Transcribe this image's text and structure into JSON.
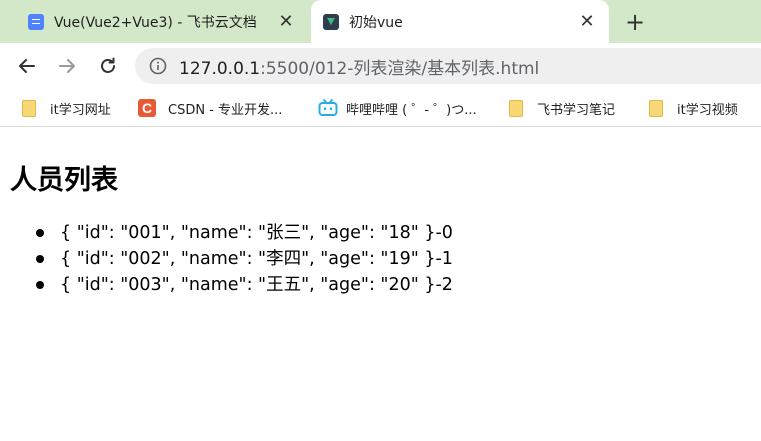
{
  "tabs": [
    {
      "title": "Vue(Vue2+Vue3) - 飞书云文档",
      "active": false
    },
    {
      "title": "初始vue",
      "active": true
    }
  ],
  "toolbar": {
    "url_host": "127.0.0.1",
    "url_rest": ":5500/012-列表渲染/基本列表.html"
  },
  "bookmarks": [
    {
      "label": "it学习网址",
      "icon": "folder-icon"
    },
    {
      "label": "CSDN - 专业开发...",
      "icon": "csdn-icon"
    },
    {
      "label": "哔哩哔哩 ( ゜- ゜)つ...",
      "icon": "bilibili-icon"
    },
    {
      "label": "飞书学习笔记",
      "icon": "folder-icon"
    },
    {
      "label": "it学习视频",
      "icon": "folder-icon"
    }
  ],
  "page": {
    "title": "人员列表",
    "items": [
      "{ \"id\": \"001\", \"name\": \"张三\", \"age\": \"18\" }-0",
      "{ \"id\": \"002\", \"name\": \"李四\", \"age\": \"19\" }-1",
      "{ \"id\": \"003\", \"name\": \"王五\", \"age\": \"20\" }-2"
    ]
  },
  "colors": {
    "tabstrip": "#d2e8c9",
    "omnibox": "#efefef",
    "accent": "#4e83fd"
  }
}
